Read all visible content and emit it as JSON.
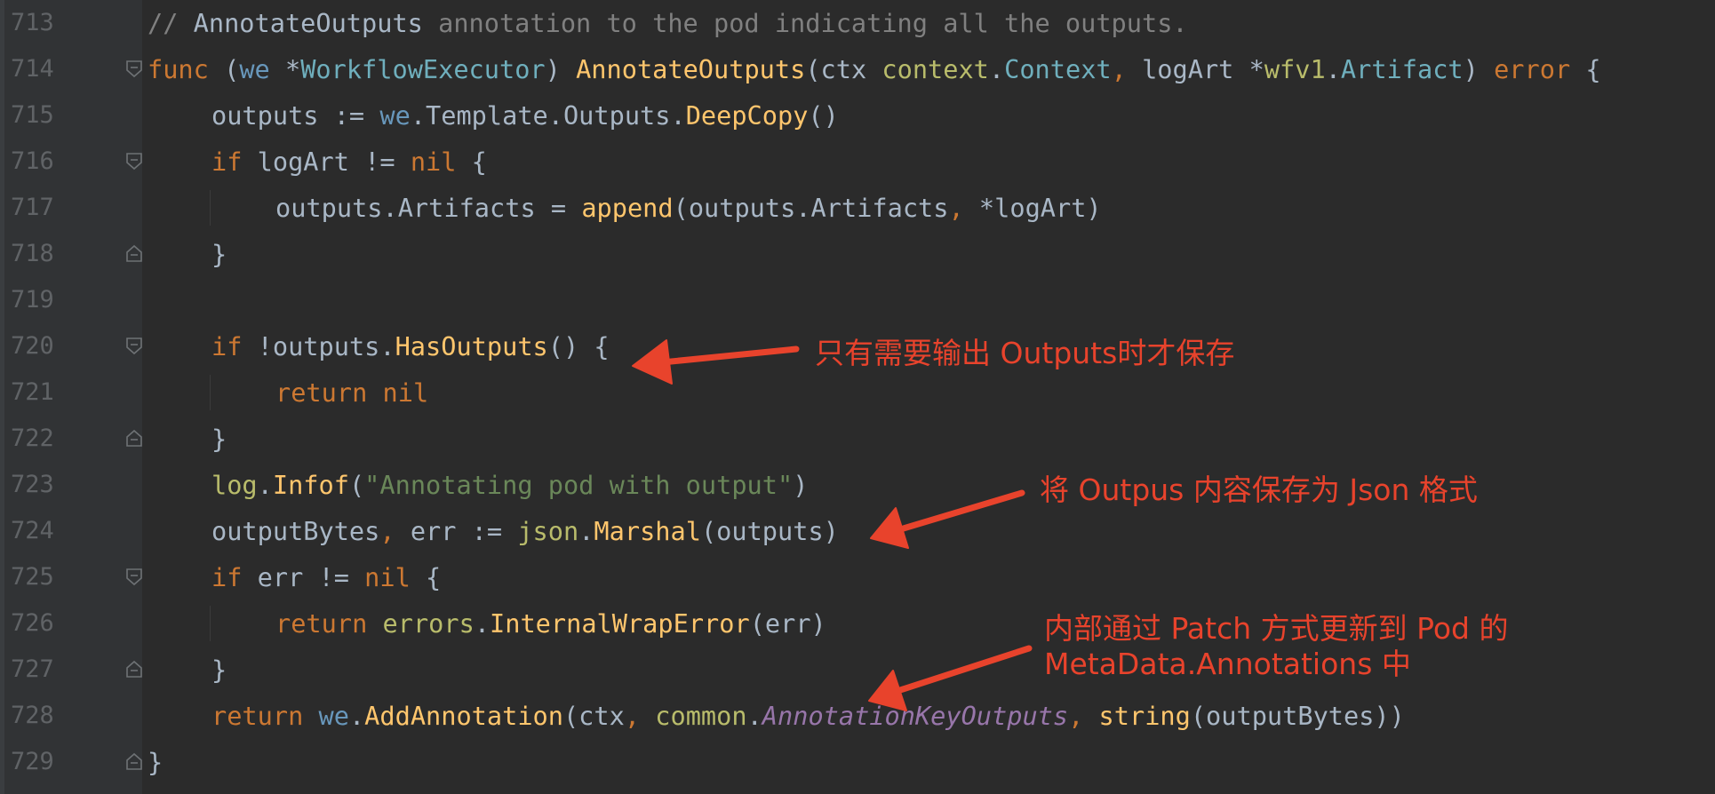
{
  "editor": {
    "colors": {
      "background": "#2b2b2b",
      "gutter": "#313335",
      "line_number": "#606366",
      "default": "#a9b7c6",
      "keyword": "#cc7832",
      "function": "#ffc66d",
      "receiver": "#6897bb",
      "type": "#6fafbd",
      "package": "#b9bc6b",
      "string": "#6a8759",
      "comment": "#808080",
      "constant": "#9876aa",
      "annotation": "#e8432c"
    },
    "lines": [
      {
        "number": "713",
        "indent": 0,
        "fold": "none",
        "tokens": [
          {
            "t": "// ",
            "c": "comment"
          },
          {
            "t": "AnnotateOutputs",
            "c": "default"
          },
          {
            "t": " annotation to the pod indicating all the outputs.",
            "c": "comment"
          }
        ]
      },
      {
        "number": "714",
        "indent": 0,
        "fold": "open",
        "tokens": [
          {
            "t": "func",
            "c": "keyword"
          },
          {
            "t": " (",
            "c": "default"
          },
          {
            "t": "we",
            "c": "receiver"
          },
          {
            "t": " *",
            "c": "default"
          },
          {
            "t": "WorkflowExecutor",
            "c": "type"
          },
          {
            "t": ") ",
            "c": "default"
          },
          {
            "t": "AnnotateOutputs",
            "c": "function"
          },
          {
            "t": "(ctx ",
            "c": "default"
          },
          {
            "t": "context",
            "c": "package"
          },
          {
            "t": ".",
            "c": "default"
          },
          {
            "t": "Context",
            "c": "type"
          },
          {
            "t": ", ",
            "c": "keyword"
          },
          {
            "t": "logArt *",
            "c": "default"
          },
          {
            "t": "wfv1",
            "c": "package"
          },
          {
            "t": ".",
            "c": "default"
          },
          {
            "t": "Artifact",
            "c": "type"
          },
          {
            "t": ") ",
            "c": "default"
          },
          {
            "t": "error",
            "c": "keyword"
          },
          {
            "t": " {",
            "c": "default"
          }
        ]
      },
      {
        "number": "715",
        "indent": 1,
        "fold": "none",
        "tokens": [
          {
            "t": "outputs := ",
            "c": "default"
          },
          {
            "t": "we",
            "c": "receiver"
          },
          {
            "t": ".Template.Outputs.",
            "c": "default"
          },
          {
            "t": "DeepCopy",
            "c": "function"
          },
          {
            "t": "()",
            "c": "default"
          }
        ]
      },
      {
        "number": "716",
        "indent": 1,
        "fold": "open",
        "tokens": [
          {
            "t": "if",
            "c": "keyword"
          },
          {
            "t": " logArt != ",
            "c": "default"
          },
          {
            "t": "nil",
            "c": "keyword"
          },
          {
            "t": " {",
            "c": "default"
          }
        ]
      },
      {
        "number": "717",
        "indent": 2,
        "fold": "none",
        "tokens": [
          {
            "t": "outputs.Artifacts = ",
            "c": "default"
          },
          {
            "t": "append",
            "c": "function"
          },
          {
            "t": "(outputs.Artifacts",
            "c": "default"
          },
          {
            "t": ", ",
            "c": "keyword"
          },
          {
            "t": "*logArt)",
            "c": "default"
          }
        ]
      },
      {
        "number": "718",
        "indent": 1,
        "fold": "close",
        "tokens": [
          {
            "t": "}",
            "c": "default"
          }
        ]
      },
      {
        "number": "719",
        "indent": 0,
        "fold": "none",
        "tokens": []
      },
      {
        "number": "720",
        "indent": 1,
        "fold": "open",
        "tokens": [
          {
            "t": "if",
            "c": "keyword"
          },
          {
            "t": " !outputs.",
            "c": "default"
          },
          {
            "t": "HasOutputs",
            "c": "function"
          },
          {
            "t": "() {",
            "c": "default"
          }
        ]
      },
      {
        "number": "721",
        "indent": 2,
        "fold": "none",
        "tokens": [
          {
            "t": "return",
            "c": "keyword"
          },
          {
            "t": " ",
            "c": "default"
          },
          {
            "t": "nil",
            "c": "keyword"
          }
        ]
      },
      {
        "number": "722",
        "indent": 1,
        "fold": "close",
        "tokens": [
          {
            "t": "}",
            "c": "default"
          }
        ]
      },
      {
        "number": "723",
        "indent": 1,
        "fold": "none",
        "tokens": [
          {
            "t": "log",
            "c": "package"
          },
          {
            "t": ".",
            "c": "default"
          },
          {
            "t": "Infof",
            "c": "function"
          },
          {
            "t": "(",
            "c": "default"
          },
          {
            "t": "\"Annotating pod with output\"",
            "c": "string"
          },
          {
            "t": ")",
            "c": "default"
          }
        ]
      },
      {
        "number": "724",
        "indent": 1,
        "fold": "none",
        "tokens": [
          {
            "t": "outputBytes",
            "c": "default"
          },
          {
            "t": ", ",
            "c": "keyword"
          },
          {
            "t": "err := ",
            "c": "default"
          },
          {
            "t": "json",
            "c": "package"
          },
          {
            "t": ".",
            "c": "default"
          },
          {
            "t": "Marshal",
            "c": "function"
          },
          {
            "t": "(outputs)",
            "c": "default"
          }
        ]
      },
      {
        "number": "725",
        "indent": 1,
        "fold": "open",
        "tokens": [
          {
            "t": "if",
            "c": "keyword"
          },
          {
            "t": " err != ",
            "c": "default"
          },
          {
            "t": "nil",
            "c": "keyword"
          },
          {
            "t": " {",
            "c": "default"
          }
        ]
      },
      {
        "number": "726",
        "indent": 2,
        "fold": "none",
        "tokens": [
          {
            "t": "return",
            "c": "keyword"
          },
          {
            "t": " ",
            "c": "default"
          },
          {
            "t": "errors",
            "c": "package"
          },
          {
            "t": ".",
            "c": "default"
          },
          {
            "t": "InternalWrapError",
            "c": "function"
          },
          {
            "t": "(err)",
            "c": "default"
          }
        ]
      },
      {
        "number": "727",
        "indent": 1,
        "fold": "close",
        "tokens": [
          {
            "t": "}",
            "c": "default"
          }
        ]
      },
      {
        "number": "728",
        "indent": 1,
        "fold": "none",
        "tokens": [
          {
            "t": "return",
            "c": "keyword"
          },
          {
            "t": " ",
            "c": "default"
          },
          {
            "t": "we",
            "c": "receiver"
          },
          {
            "t": ".",
            "c": "default"
          },
          {
            "t": "AddAnnotation",
            "c": "function"
          },
          {
            "t": "(ctx",
            "c": "default"
          },
          {
            "t": ", ",
            "c": "keyword"
          },
          {
            "t": "common",
            "c": "package"
          },
          {
            "t": ".",
            "c": "default"
          },
          {
            "t": "AnnotationKeyOutputs",
            "c": "constant"
          },
          {
            "t": ", ",
            "c": "keyword"
          },
          {
            "t": "string",
            "c": "function"
          },
          {
            "t": "(outputBytes))",
            "c": "default"
          }
        ]
      },
      {
        "number": "729",
        "indent": 0,
        "fold": "close",
        "tokens": [
          {
            "t": "}",
            "c": "default"
          }
        ]
      }
    ]
  },
  "annotations": [
    {
      "text": "只有需要输出 Outputs时才保存"
    },
    {
      "text": "将 Outpus 内容保存为 Json 格式"
    },
    {
      "text": "内部通过 Patch 方式更新到 Pod 的\nMetaData.Annotations 中"
    }
  ]
}
